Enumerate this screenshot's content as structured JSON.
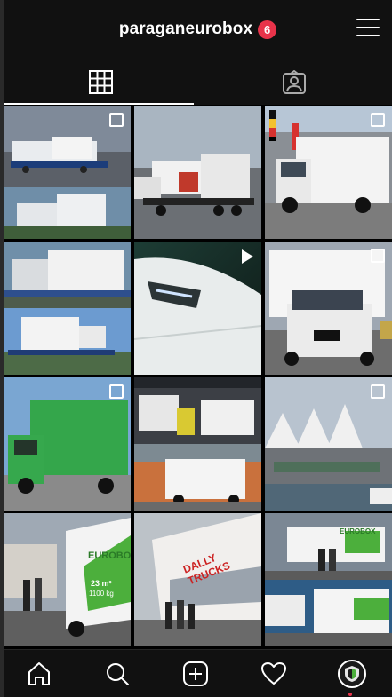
{
  "header": {
    "username": "paraganeurobox",
    "notification_count": "6"
  },
  "tabs": [
    {
      "icon": "grid-icon",
      "active": true
    },
    {
      "icon": "tagged-user-icon",
      "active": false
    }
  ],
  "grid": {
    "posts": [
      {
        "subject": "two trucks with box bodies on transport trailer, street scene",
        "type": "carousel"
      },
      {
        "subject": "MAN truck transporting white box vans",
        "type": "photo"
      },
      {
        "subject": "white box van with flags in front of building",
        "type": "carousel"
      },
      {
        "subject": "white box vans loaded on trailers",
        "type": "photo"
      },
      {
        "subject": "close-up of van headlight",
        "type": "video"
      },
      {
        "subject": "Renault white box van front view",
        "type": "carousel"
      },
      {
        "subject": "green box van",
        "type": "carousel"
      },
      {
        "subject": "box vans in showroom hall",
        "type": "photo"
      },
      {
        "subject": "white van in front of angular modern buildings",
        "type": "carousel"
      },
      {
        "subject": "green and white EUROBOX van with people",
        "type": "photo",
        "text": [
          "EUROBOX",
          "23 m³",
          "1100 kg"
        ]
      },
      {
        "subject": "people in front of dealership building",
        "type": "photo",
        "text": [
          "DALLY TRUCKS"
        ]
      },
      {
        "subject": "white EUROBOX vans and people at dealership",
        "type": "photo",
        "text": [
          "EUROBOX"
        ]
      }
    ]
  },
  "bottom_nav": [
    {
      "icon": "home-icon"
    },
    {
      "icon": "search-icon"
    },
    {
      "icon": "add-post-icon"
    },
    {
      "icon": "heart-icon"
    },
    {
      "icon": "profile-avatar"
    }
  ]
}
